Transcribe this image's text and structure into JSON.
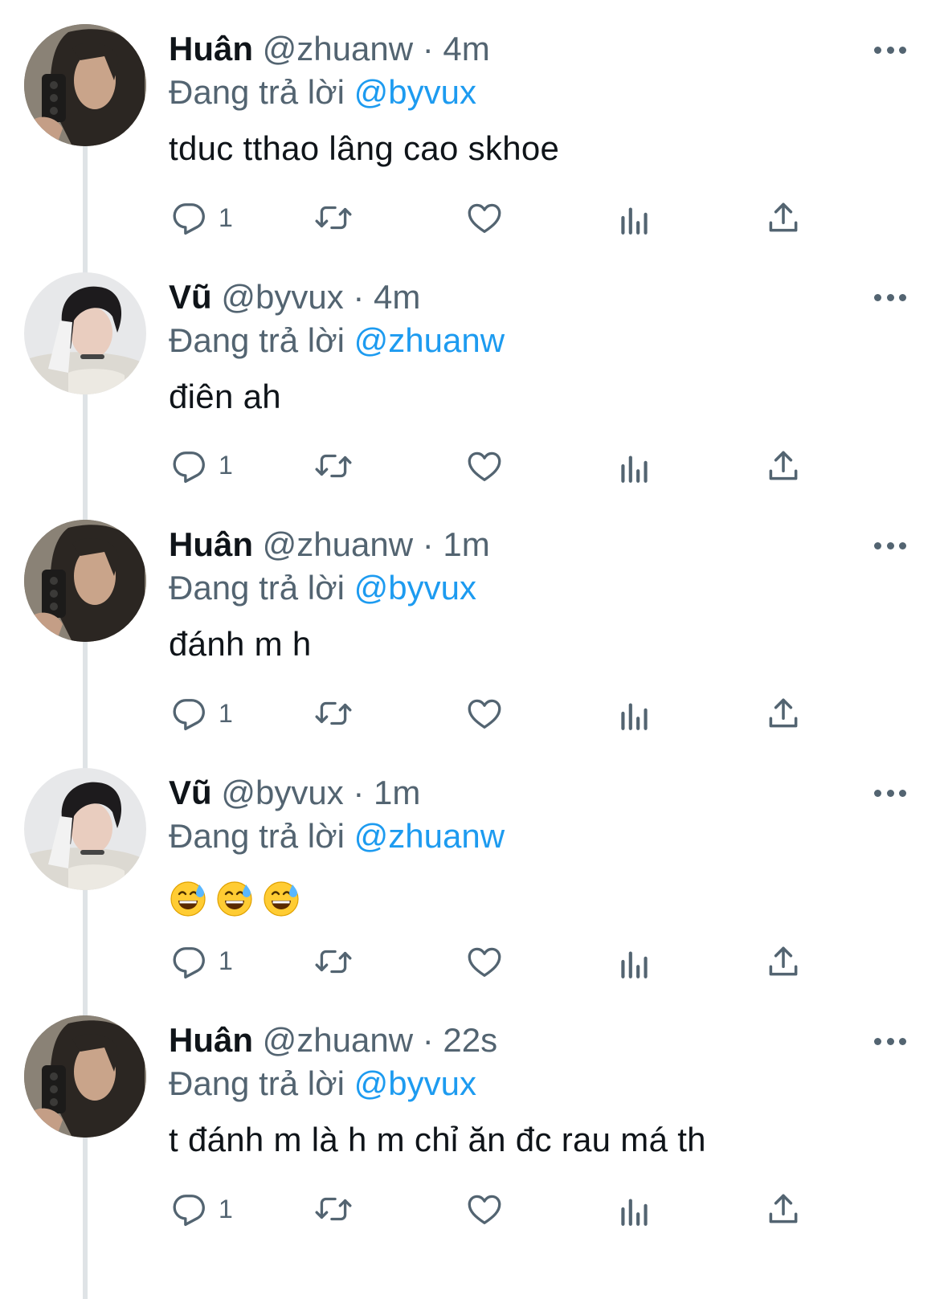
{
  "thread": [
    {
      "avatar": "huan-avatar",
      "name": "Huân",
      "handle": "@zhuanw",
      "separator": "·",
      "time": "4m",
      "replying_prefix": "Đang trả lời",
      "replying_to": "@byvux",
      "text": "tduc tthao lâng cao skhoe",
      "reply_count": "1"
    },
    {
      "avatar": "vu-avatar",
      "name": "Vũ",
      "handle": "@byvux",
      "separator": "·",
      "time": "4m",
      "replying_prefix": "Đang trả lời",
      "replying_to": "@zhuanw",
      "text": "điên ah",
      "reply_count": "1"
    },
    {
      "avatar": "huan-avatar",
      "name": "Huân",
      "handle": "@zhuanw",
      "separator": "·",
      "time": "1m",
      "replying_prefix": "Đang trả lời",
      "replying_to": "@byvux",
      "text": "đánh m h",
      "reply_count": "1"
    },
    {
      "avatar": "vu-avatar",
      "name": "Vũ",
      "handle": "@byvux",
      "separator": "·",
      "time": "1m",
      "replying_prefix": "Đang trả lời",
      "replying_to": "@zhuanw",
      "text": "",
      "emoji": [
        "grinning-sweat-emoji",
        "grinning-sweat-emoji",
        "grinning-sweat-emoji"
      ],
      "reply_count": "1"
    },
    {
      "avatar": "huan-avatar",
      "name": "Huân",
      "handle": "@zhuanw",
      "separator": "·",
      "time": "22s",
      "replying_prefix": "Đang trả lời",
      "replying_to": "@byvux",
      "text": "t đánh m là h m chỉ ăn đc rau má th",
      "reply_count": "1"
    }
  ],
  "icons": {
    "reply": "reply-icon",
    "retweet": "retweet-icon",
    "like": "heart-icon",
    "views": "views-icon",
    "share": "share-icon",
    "more": "more-icon"
  },
  "colors": {
    "text": "#0f1419",
    "secondary": "#536471",
    "link": "#1d9bf0",
    "thread_line": "#dfe3e6"
  }
}
